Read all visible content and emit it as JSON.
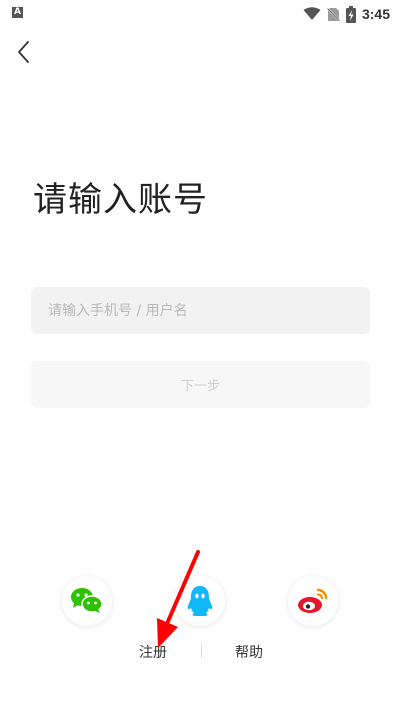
{
  "status_bar": {
    "left_icon_letter": "A",
    "time": "3:45",
    "icons": [
      "app-notification-icon",
      "wifi-icon",
      "no-sim-icon",
      "battery-charging-icon"
    ]
  },
  "header": {
    "back_icon": "chevron-left-icon"
  },
  "title": "请输入账号",
  "account_input": {
    "placeholder": "请输入手机号 / 用户名",
    "value": ""
  },
  "next_button": {
    "label": "下一步"
  },
  "social_login": [
    {
      "name": "wechat",
      "icon": "wechat-icon",
      "color": "#2dc100"
    },
    {
      "name": "qq",
      "icon": "qq-icon",
      "color": "#12b7f5"
    },
    {
      "name": "weibo",
      "icon": "weibo-icon",
      "color": "#e6162d"
    }
  ],
  "footer": {
    "register_label": "注册",
    "help_label": "帮助"
  },
  "annotation": {
    "arrow_color": "#ff0000"
  }
}
